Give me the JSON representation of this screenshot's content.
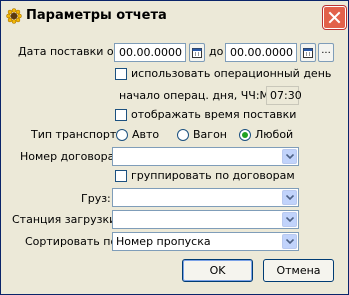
{
  "window": {
    "title": "Параметры отчета"
  },
  "delivery_date": {
    "label": "Дата поставки от:",
    "from_value": "00.00.0000",
    "to_label": "до",
    "to_value": "00.00.0000",
    "more_label": "..."
  },
  "use_operational_day": {
    "label": "использовать операционный день"
  },
  "operational_day_start": {
    "label": "начало операц. дня, ЧЧ:ММ:",
    "value": "07:30"
  },
  "show_delivery_time": {
    "label": "отображать время поставки"
  },
  "transport_type": {
    "label": "Тип транспорта:",
    "options": [
      "Авто",
      "Вагон",
      "Любой"
    ],
    "selected": "Любой"
  },
  "contract_number": {
    "label": "Номер договора:",
    "value": ""
  },
  "group_by_contracts": {
    "label": "группировать по договорам"
  },
  "cargo": {
    "label": "Груз:",
    "value": ""
  },
  "loading_station": {
    "label": "Станция загрузки:",
    "value": ""
  },
  "sort_by": {
    "label": "Сортировать по:",
    "value": "Номер пропуска"
  },
  "buttons": {
    "ok": "OK",
    "cancel": "Отмена"
  }
}
